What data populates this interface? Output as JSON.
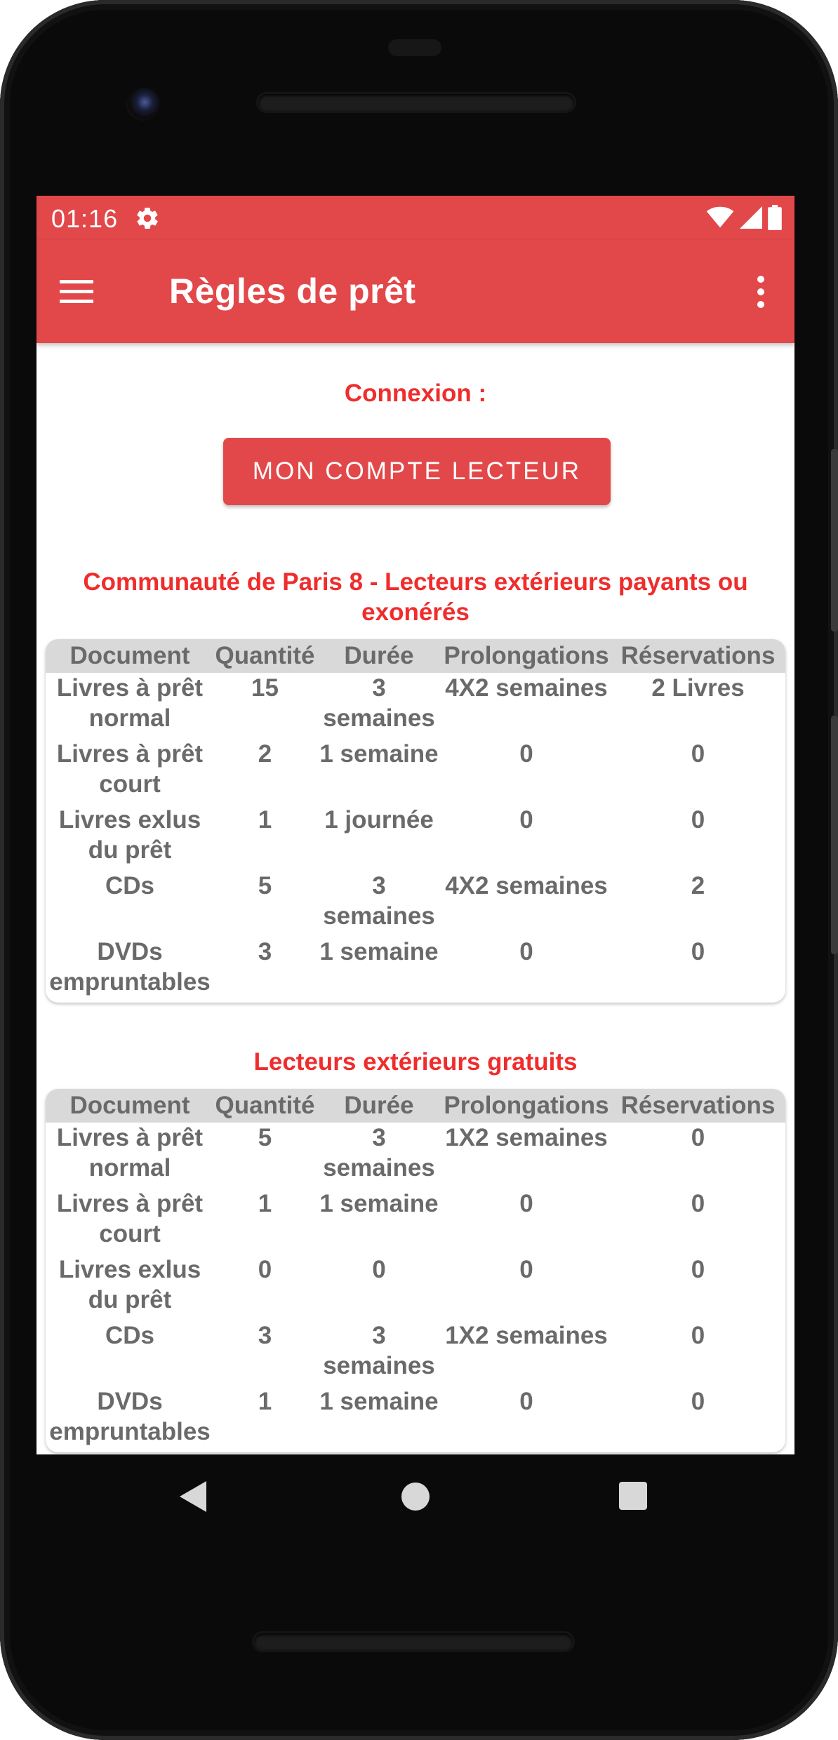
{
  "status_bar": {
    "time": "01:16",
    "icons": [
      "gear-icon",
      "wifi-icon",
      "signal-icon",
      "battery-icon"
    ]
  },
  "app_bar": {
    "title": "Règles de prêt",
    "menu_icon": "hamburger-menu-icon",
    "overflow_icon": "more-vertical-icon"
  },
  "login": {
    "label": "Connexion :",
    "button_label": "MON COMPTE LECTEUR"
  },
  "columns": [
    "Document",
    "Quantité",
    "Durée",
    "Prolongations",
    "Réservations"
  ],
  "sections": [
    {
      "title": "Communauté de Paris 8 - Lecteurs extérieurs payants ou exonérés",
      "rows": [
        {
          "document": "Livres à prêt normal",
          "quantite": "15",
          "duree": "3 semaines",
          "prolongations": "4X2 semaines",
          "reservations": "2 Livres"
        },
        {
          "document": "Livres à prêt court",
          "quantite": "2",
          "duree": "1 semaine",
          "prolongations": "0",
          "reservations": "0"
        },
        {
          "document": "Livres exlus du prêt",
          "quantite": "1",
          "duree": "1 journée",
          "prolongations": "0",
          "reservations": "0"
        },
        {
          "document": "CDs",
          "quantite": "5",
          "duree": "3 semaines",
          "prolongations": "4X2 semaines",
          "reservations": "2"
        },
        {
          "document": "DVDs empruntables",
          "quantite": "3",
          "duree": "1 semaine",
          "prolongations": "0",
          "reservations": "0"
        }
      ]
    },
    {
      "title": "Lecteurs extérieurs gratuits",
      "rows": [
        {
          "document": "Livres à prêt normal",
          "quantite": "5",
          "duree": "3 semaines",
          "prolongations": "1X2 semaines",
          "reservations": "0"
        },
        {
          "document": "Livres à prêt court",
          "quantite": "1",
          "duree": "1 semaine",
          "prolongations": "0",
          "reservations": "0"
        },
        {
          "document": "Livres exlus du prêt",
          "quantite": "0",
          "duree": "0",
          "prolongations": "0",
          "reservations": "0"
        },
        {
          "document": "CDs",
          "quantite": "3",
          "duree": "3 semaines",
          "prolongations": "1X2 semaines",
          "reservations": "0"
        },
        {
          "document": "DVDs empruntables",
          "quantite": "1",
          "duree": "1 semaine",
          "prolongations": "0",
          "reservations": "0"
        }
      ]
    }
  ],
  "nav_bar": {
    "icons": [
      "back-icon",
      "home-icon",
      "recents-icon"
    ]
  },
  "colors": {
    "accent": "#e2484a",
    "heading_red": "#f02c2c",
    "table_text": "#6a6a6a",
    "table_header_bg": "#d9d9d9"
  }
}
